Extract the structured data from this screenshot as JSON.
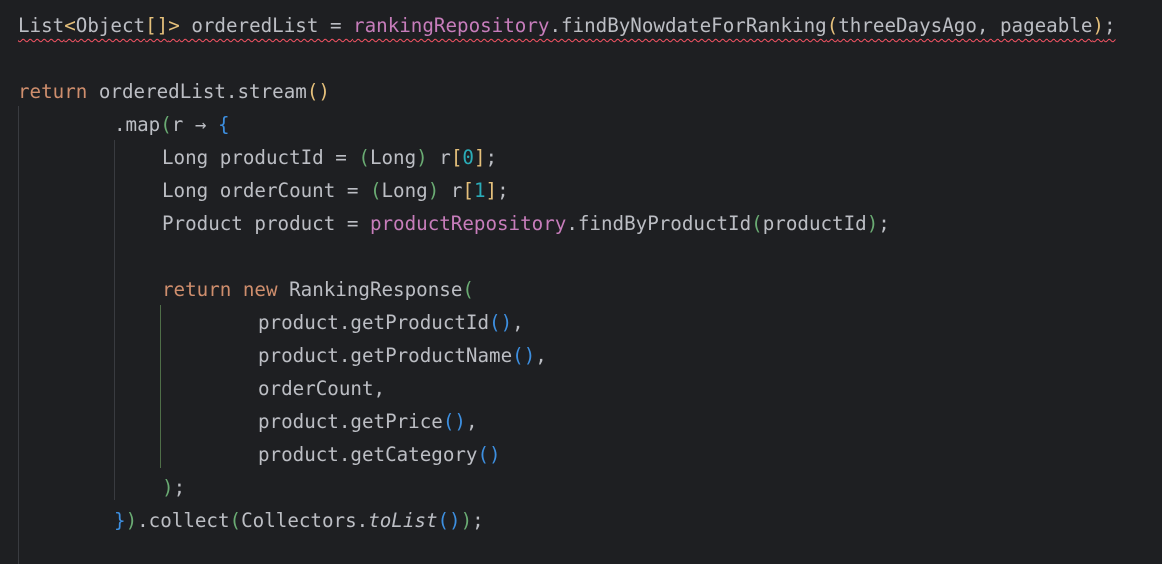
{
  "code": {
    "l1": {
      "list_type": "List",
      "lt": "<",
      "obj_type": "Object",
      "arr": "[]",
      "gt": ">",
      "decl": " orderedList = ",
      "repo": "rankingRepository",
      "method": ".findByNowdateForRanking",
      "open": "(",
      "args": "threeDaysAgo, pageable",
      "close": ")",
      "semi": ";"
    },
    "l2": {
      "kw_return": "return",
      "rest": " orderedList.stream",
      "parens": "()"
    },
    "l3": {
      "map": ".map",
      "open": "(",
      "lambda": "r → ",
      "brace": "{"
    },
    "l4": {
      "decl": "Long productId = ",
      "cast_open": "(",
      "cast_type": "Long",
      "cast_close": ")",
      "var": " r",
      "br_open": "[",
      "index": "0",
      "br_close": "]",
      "semi": ";"
    },
    "l5": {
      "decl": "Long orderCount = ",
      "cast_open": "(",
      "cast_type": "Long",
      "cast_close": ")",
      "var": " r",
      "br_open": "[",
      "index": "1",
      "br_close": "]",
      "semi": ";"
    },
    "l6": {
      "decl": "Product product = ",
      "repo": "productRepository",
      "method": ".findByProductId",
      "open": "(",
      "arg": "productId",
      "close": ")",
      "semi": ";"
    },
    "l7": {
      "kw_return": "return",
      "kw_new": "new",
      "ctor": "RankingResponse",
      "open": "("
    },
    "l8": {
      "text": "product.getProductId",
      "parens": "()",
      "comma": ","
    },
    "l9": {
      "text": "product.getProductName",
      "parens": "()",
      "comma": ","
    },
    "l10": {
      "text": "orderCount,"
    },
    "l11": {
      "text": "product.getPrice",
      "parens": "()",
      "comma": ","
    },
    "l12": {
      "text": "product.getCategory",
      "parens": "()"
    },
    "l13": {
      "close": ")",
      "semi": ";"
    },
    "l14": {
      "brace": "}",
      "close": ")",
      "collect": ".collect",
      "open": "(",
      "collectors": "Collectors.",
      "tolist": "toList",
      "inner": "()",
      "close2": ")",
      "semi": ";"
    }
  },
  "colors": {
    "background": "#1e1f22",
    "text": "#bcbec4",
    "keyword": "#cf8e6d",
    "field": "#c77dbb",
    "number": "#2aacb8",
    "error_underline": "#f75464"
  }
}
